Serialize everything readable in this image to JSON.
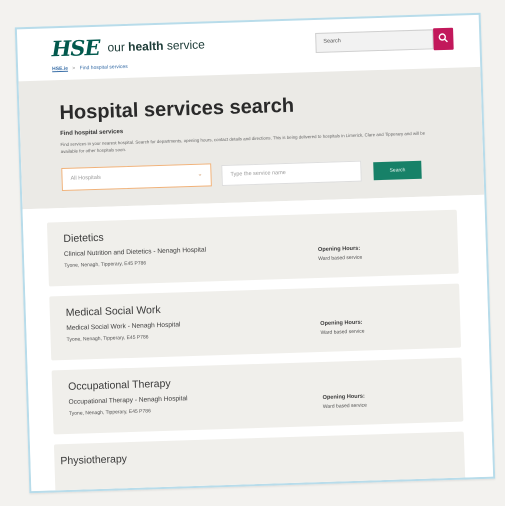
{
  "header": {
    "logo_mark": "HSE",
    "logo_text_prefix": "our",
    "logo_text_bold": "health",
    "logo_text_suffix": "service",
    "search_placeholder": "Search"
  },
  "breadcrumb": {
    "home": "HSE.ie",
    "separator": ">",
    "current": "Find hospital services"
  },
  "hero": {
    "title": "Hospital services search",
    "subtitle": "Find hospital services",
    "description": "Find services in your nearest hospital. Search for departments, opening hours, contact details and directions. This is being delivered to hospitals in Limerick, Clare and Tipperary and will be available for other hospitals soon.",
    "select_value": "All Hospitals",
    "input_placeholder": "Type the service name",
    "submit_label": "Search"
  },
  "results": [
    {
      "title": "Dietetics",
      "service": "Clinical Nutrition and Dietetics - Nenagh Hospital",
      "address": "Tyone, Nenagh, Tipperary, E45 P786",
      "hours_label": "Opening Hours:",
      "hours_value": "Ward based service"
    },
    {
      "title": "Medical Social Work",
      "service": "Medical Social Work - Nenagh Hospital",
      "address": "Tyone, Nenagh, Tipperary, E45 P786",
      "hours_label": "Opening Hours:",
      "hours_value": "Ward based service"
    },
    {
      "title": "Occupational Therapy",
      "service": "Occupational Therapy - Nenagh Hospital",
      "address": "Tyone, Nenagh, Tipperary, E45 P786",
      "hours_label": "Opening Hours:",
      "hours_value": "Ward based service"
    },
    {
      "title": "Physiotherapy"
    }
  ],
  "colors": {
    "brand": "#02594d",
    "search_button": "#c2185b",
    "submit_button": "#178168",
    "select_border": "#f0b27a",
    "frame_border": "#b8dcea"
  },
  "icons": {
    "logo": "hse-logo-icon",
    "search": "search-icon",
    "dropdown": "chevron-down-icon"
  }
}
